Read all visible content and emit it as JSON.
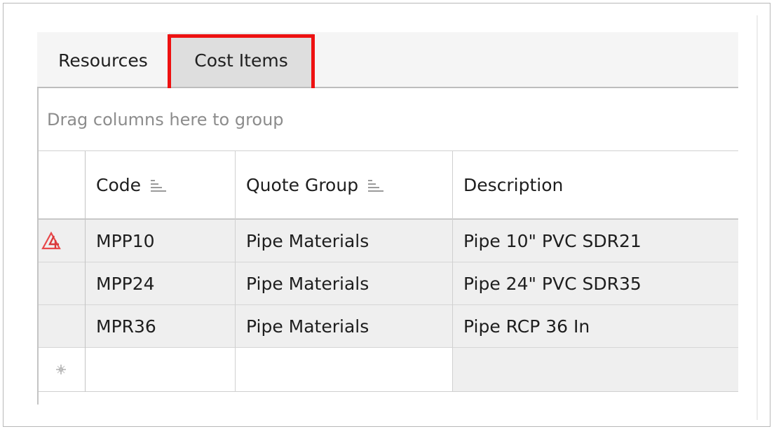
{
  "tabs": [
    {
      "label": "Resources",
      "selected": false
    },
    {
      "label": "Cost Items",
      "selected": true
    }
  ],
  "highlight_color": "#ee1111",
  "grid": {
    "group_panel_text": "Drag columns here to group",
    "columns": [
      {
        "label": "Code",
        "sortable_icon": "sort-lines-icon"
      },
      {
        "label": "Quote Group",
        "sortable_icon": "sort-lines-icon"
      },
      {
        "label": "Description"
      }
    ],
    "rows": [
      {
        "code": "MPP10",
        "quote_group": "Pipe Materials",
        "description": "Pipe 10\" PVC SDR21",
        "indicator": "warning-triangle-icon"
      },
      {
        "code": "MPP24",
        "quote_group": "Pipe Materials",
        "description": "Pipe 24\" PVC SDR35"
      },
      {
        "code": "MPR36",
        "quote_group": "Pipe Materials",
        "description": "Pipe RCP 36 In"
      }
    ],
    "new_row_indicator": "new-row-asterisk-icon"
  }
}
